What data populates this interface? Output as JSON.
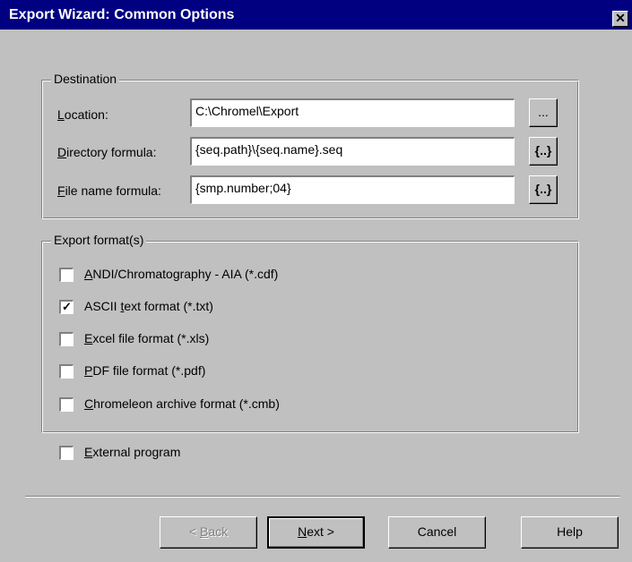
{
  "window": {
    "title": "Export Wizard: Common Options",
    "close_glyph": "✕"
  },
  "destination": {
    "legend": "Destination",
    "location": {
      "label_key": "L",
      "label_rest": "ocation:",
      "value": "C:\\Chromel\\Export",
      "browse": "..."
    },
    "directory_formula": {
      "label_key": "D",
      "label_rest": "irectory formula:",
      "value": "{seq.path}\\{seq.name}.seq",
      "button": "{..}"
    },
    "file_name_formula": {
      "label_key": "F",
      "label_rest": "ile name formula:",
      "value": "{smp.number;04}",
      "button": "{..}"
    }
  },
  "export_formats": {
    "legend": "Export format(s)",
    "items": [
      {
        "key": "A",
        "rest": "NDI/Chromatography - AIA (*.cdf)",
        "checked": false,
        "mark": ""
      },
      {
        "pre": "ASCII ",
        "key": "t",
        "rest": "ext format (*.txt)",
        "checked": true,
        "mark": "✓"
      },
      {
        "key": "E",
        "rest": "xcel file format (*.xls)",
        "checked": false,
        "mark": ""
      },
      {
        "key": "P",
        "rest": "DF file format (*.pdf)",
        "checked": false,
        "mark": ""
      },
      {
        "key": "C",
        "rest": "hromeleon archive format (*.cmb)",
        "checked": false,
        "mark": ""
      }
    ]
  },
  "external_program": {
    "key": "E",
    "rest": "xternal program",
    "checked": false,
    "mark": ""
  },
  "buttons": {
    "back": {
      "pre": "< ",
      "key": "B",
      "rest": "ack"
    },
    "next": {
      "key": "N",
      "rest": "ext >"
    },
    "cancel": "Cancel",
    "help": "Help"
  }
}
